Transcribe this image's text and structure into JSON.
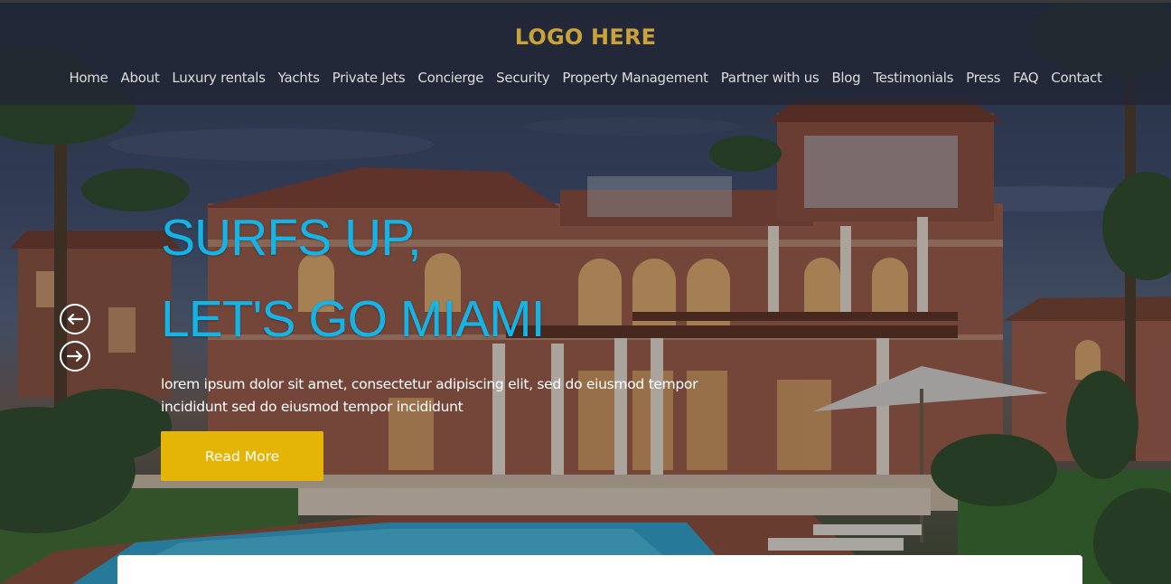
{
  "header": {
    "logo": "LOGO HERE",
    "nav": [
      {
        "label": "Home"
      },
      {
        "label": "About"
      },
      {
        "label": "Luxury rentals"
      },
      {
        "label": "Yachts"
      },
      {
        "label": "Private Jets"
      },
      {
        "label": "Concierge"
      },
      {
        "label": "Security"
      },
      {
        "label": "Property Management"
      },
      {
        "label": "Partner with us"
      },
      {
        "label": "Blog"
      },
      {
        "label": "Testimonials"
      },
      {
        "label": "Press"
      },
      {
        "label": "FAQ"
      },
      {
        "label": "Contact"
      }
    ]
  },
  "hero": {
    "headline_line1": "SURFS UP,",
    "headline_line2": "LET'S GO MIAMI",
    "blurb": "lorem ipsum dolor sit amet, consectetur adipiscing elit, sed do eiusmod tempor incididunt sed do eiusmod tempor incididunt",
    "cta_label": "Read More",
    "background_image": "luxury villa with pool at dusk",
    "prev_icon": "arrow-left-icon",
    "next_icon": "arrow-right-icon"
  },
  "colors": {
    "logo": "#c9a23a",
    "headline": "#14b4e6",
    "cta": "#e4b506",
    "header_bg": "#222634",
    "nav_text": "#dcdcdc"
  }
}
